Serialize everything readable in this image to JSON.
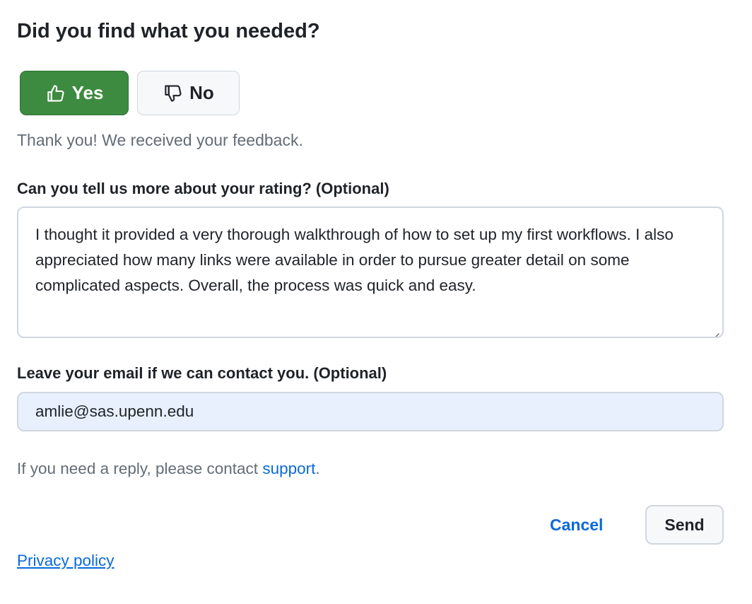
{
  "feedback": {
    "title": "Did you find what you needed?",
    "yes_label": "Yes",
    "no_label": "No",
    "selected": "Yes",
    "thanks_text": "Thank you! We received your feedback.",
    "rating_label": "Can you tell us more about your rating? (Optional)",
    "rating_text": "I thought it provided a very thorough walkthrough of how to set up my first workflows. I also appreciated how many links were available in order to pursue greater detail on some complicated aspects. Overall, the process was quick and easy.",
    "email_label": "Leave your email if we can contact you. (Optional)",
    "email_value": "amlie@sas.upenn.edu",
    "reply_prefix": "If you need a reply, please contact ",
    "support_link": "support",
    "reply_suffix": ".",
    "cancel_label": "Cancel",
    "send_label": "Send",
    "privacy_label": "Privacy policy"
  },
  "icons": {
    "yes": "thumbs-up-icon",
    "no": "thumbs-down-icon"
  },
  "colors": {
    "yes_bg": "#3d8b40",
    "link": "#0969da",
    "muted": "#636c76",
    "email_bg": "#e8f0fe"
  }
}
